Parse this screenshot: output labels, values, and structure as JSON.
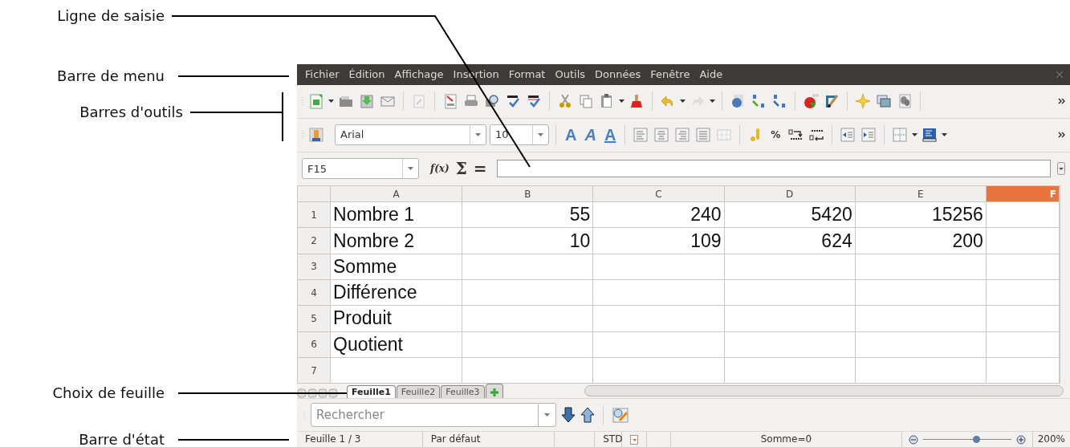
{
  "annotations": [
    {
      "label": "Ligne de saisie",
      "kind": "input_line"
    },
    {
      "label": "Barre de menu",
      "kind": "menu"
    },
    {
      "label": "Barres d'outils",
      "kind": "toolbars"
    },
    {
      "label": "Choix de feuille",
      "kind": "sheets"
    },
    {
      "label": "Barre d'état",
      "kind": "status"
    }
  ],
  "menu": [
    {
      "label": "Fichier"
    },
    {
      "label": "Édition"
    },
    {
      "label": "Affichage"
    },
    {
      "label": "Insertion"
    },
    {
      "label": "Format"
    },
    {
      "label": "Outils"
    },
    {
      "label": "Données"
    },
    {
      "label": "Fenêtre"
    },
    {
      "label": "Aide"
    }
  ],
  "format_toolbar": {
    "font": "Arial",
    "size": "10",
    "style_buttons": [
      {
        "kind": "bold",
        "glyph": "A"
      },
      {
        "kind": "italic",
        "glyph": "A"
      },
      {
        "kind": "underline",
        "glyph": "A"
      }
    ],
    "percent": "%"
  },
  "formula_bar": {
    "cell_ref": "F15",
    "function_wizard": "f(x)",
    "sum": "Σ",
    "equals": "="
  },
  "table": {
    "columns": [
      {
        "label": "A",
        "selected": false
      },
      {
        "label": "B",
        "selected": false
      },
      {
        "label": "C",
        "selected": false
      },
      {
        "label": "D",
        "selected": false
      },
      {
        "label": "E",
        "selected": false
      },
      {
        "label": "F",
        "selected": true
      }
    ],
    "rows": [
      {
        "header": "1",
        "cells": [
          "Nombre 1",
          "55",
          "240",
          "5420",
          "15256"
        ]
      },
      {
        "header": "2",
        "cells": [
          "Nombre 2",
          "10",
          "109",
          "624",
          "200"
        ]
      },
      {
        "header": "3",
        "cells": [
          "Somme"
        ]
      },
      {
        "header": "4",
        "cells": [
          "Différence"
        ]
      },
      {
        "header": "5",
        "cells": [
          "Produit"
        ]
      },
      {
        "header": "6",
        "cells": [
          "Quotient"
        ]
      },
      {
        "header": "7",
        "cells": []
      }
    ]
  },
  "sheet_tabs": [
    {
      "label": "Feuille1",
      "selected": true
    },
    {
      "label": "Feuille2",
      "selected": false
    },
    {
      "label": "Feuille3",
      "selected": false
    }
  ],
  "find_bar": {
    "placeholder": "Rechercher"
  },
  "status_bar": {
    "sheet": "Feuille 1 / 3",
    "style": "Par défaut",
    "mode": "STD",
    "sum": "Somme=0",
    "zoom": {
      "level": 0.6,
      "reading": "200%"
    }
  }
}
